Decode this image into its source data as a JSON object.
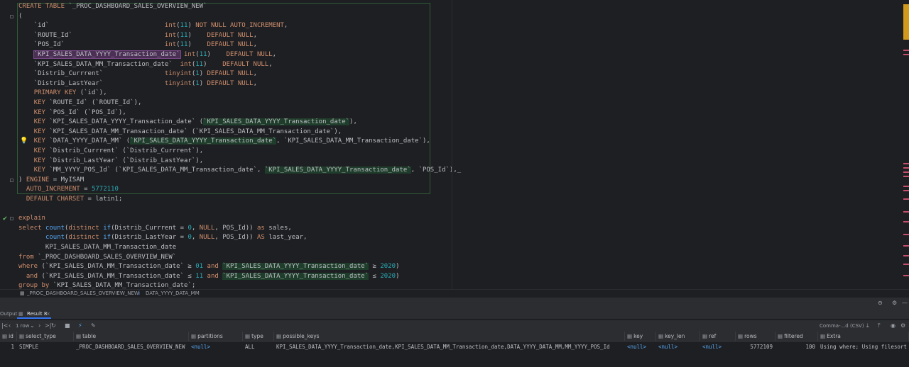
{
  "editor": {
    "lines": [
      [
        [
          "kw",
          "CREATE TABLE "
        ],
        [
          "id",
          "`_PROC_DASHBOARD_SALES_OVERVIEW_NEW`"
        ]
      ],
      [
        [
          "id",
          "("
        ]
      ],
      [
        [
          "id",
          "    `id`                              "
        ],
        [
          "kw",
          "int"
        ],
        [
          "id",
          "("
        ],
        [
          "num",
          "11"
        ],
        [
          "id",
          ") "
        ],
        [
          "kw",
          "NOT NULL AUTO_INCREMENT"
        ],
        [
          "id",
          ","
        ]
      ],
      [
        [
          "id",
          "    `ROUTE_Id`                        "
        ],
        [
          "kw",
          "int"
        ],
        [
          "id",
          "("
        ],
        [
          "num",
          "11"
        ],
        [
          "id",
          ")    "
        ],
        [
          "kw",
          "DEFAULT NULL"
        ],
        [
          "id",
          ","
        ]
      ],
      [
        [
          "id",
          "    `POS_Id`                          "
        ],
        [
          "kw",
          "int"
        ],
        [
          "id",
          "("
        ],
        [
          "num",
          "11"
        ],
        [
          "id",
          ")    "
        ],
        [
          "kw",
          "DEFAULT NULL"
        ],
        [
          "id",
          ","
        ]
      ],
      [
        [
          "id",
          "    "
        ],
        [
          "hl-purple",
          "`KPI_SALES_DATA_YYYY_Transaction_date`"
        ],
        [
          "id",
          " "
        ],
        [
          "kw",
          "int"
        ],
        [
          "id",
          "("
        ],
        [
          "num",
          "11"
        ],
        [
          "id",
          ")    "
        ],
        [
          "kw",
          "DEFAULT NULL"
        ],
        [
          "id",
          ","
        ]
      ],
      [
        [
          "id",
          "    `KPI_SALES_DATA_MM_Transaction_date`  "
        ],
        [
          "kw",
          "int"
        ],
        [
          "id",
          "("
        ],
        [
          "num",
          "11"
        ],
        [
          "id",
          ")    "
        ],
        [
          "kw",
          "DEFAULT NULL"
        ],
        [
          "id",
          ","
        ]
      ],
      [
        [
          "id",
          "    `Distrib_Currrent`                "
        ],
        [
          "kw",
          "tinyint"
        ],
        [
          "id",
          "("
        ],
        [
          "num",
          "1"
        ],
        [
          "id",
          ") "
        ],
        [
          "kw",
          "DEFAULT NULL"
        ],
        [
          "id",
          ","
        ]
      ],
      [
        [
          "id",
          "    `Distrib_LastYear`                "
        ],
        [
          "kw",
          "tinyint"
        ],
        [
          "id",
          "("
        ],
        [
          "num",
          "1"
        ],
        [
          "id",
          ") "
        ],
        [
          "kw",
          "DEFAULT NULL"
        ],
        [
          "id",
          ","
        ]
      ],
      [
        [
          "id",
          "    "
        ],
        [
          "kw",
          "PRIMARY KEY"
        ],
        [
          "id",
          " (`id`),"
        ]
      ],
      [
        [
          "id",
          "    "
        ],
        [
          "kw",
          "KEY"
        ],
        [
          "id",
          " `ROUTE_Id` (`ROUTE_Id`),"
        ]
      ],
      [
        [
          "id",
          "    "
        ],
        [
          "kw",
          "KEY"
        ],
        [
          "id",
          " `POS_Id` (`POS_Id`),"
        ]
      ],
      [
        [
          "id",
          "    "
        ],
        [
          "kw",
          "KEY"
        ],
        [
          "id",
          " `KPI_SALES_DATA_YYYY_Transaction_date` ("
        ],
        [
          "hl-green",
          "`KPI_SALES_DATA_YYYY_Transaction_date`"
        ],
        [
          "id",
          "),"
        ]
      ],
      [
        [
          "id",
          "    "
        ],
        [
          "kw",
          "KEY"
        ],
        [
          "id",
          " `KPI_SALES_DATA_MM_Transaction_date` (`KPI_SALES_DATA_MM_Transaction_date`),"
        ]
      ],
      [
        [
          "id",
          "    "
        ],
        [
          "kw",
          "KEY"
        ],
        [
          "id",
          " `DATA_YYYY_DATA_MM` ("
        ],
        [
          "hl-green",
          "`KPI_SALES_DATA_YYYY_Transaction_date`"
        ],
        [
          "id",
          ", `KPI_SALES_DATA_MM_Transaction_date`),"
        ]
      ],
      [
        [
          "id",
          "    "
        ],
        [
          "kw",
          "KEY"
        ],
        [
          "id",
          " `Distrib_Currrent` (`Distrib_Currrent`),"
        ]
      ],
      [
        [
          "id",
          "    "
        ],
        [
          "kw",
          "KEY"
        ],
        [
          "id",
          " `Distrib_LastYear` (`Distrib_LastYear`),"
        ]
      ],
      [
        [
          "id",
          "    "
        ],
        [
          "kw",
          "KEY"
        ],
        [
          "id",
          " `MM_YYYY_POS_Id` (`KPI_SALES_DATA_MM_Transaction_date`, "
        ],
        [
          "hl-green",
          "`KPI_SALES_DATA_YYYY_Transaction_date`"
        ],
        [
          "id",
          ", `POS_Id`),_"
        ]
      ],
      [
        [
          "id",
          ") "
        ],
        [
          "kw",
          "ENGINE"
        ],
        [
          "id",
          " = MyISAM"
        ]
      ],
      [
        [
          "id",
          "  "
        ],
        [
          "kw",
          "AUTO_INCREMENT"
        ],
        [
          "id",
          " = "
        ],
        [
          "num",
          "5772110"
        ]
      ],
      [
        [
          "id",
          "  "
        ],
        [
          "kw",
          "DEFAULT CHARSET"
        ],
        [
          "id",
          " = latin1;"
        ]
      ],
      [
        [
          "id",
          ""
        ]
      ],
      [
        [
          "kw",
          "explain"
        ]
      ],
      [
        [
          "kw",
          "select "
        ],
        [
          "fn",
          "count"
        ],
        [
          "id",
          "("
        ],
        [
          "kw",
          "distinct "
        ],
        [
          "fn",
          "if"
        ],
        [
          "id",
          "(Distrib_Currrent = "
        ],
        [
          "num",
          "0"
        ],
        [
          "id",
          ", "
        ],
        [
          "kw",
          "NULL"
        ],
        [
          "id",
          ", POS_Id)) "
        ],
        [
          "kw",
          "as"
        ],
        [
          "id",
          " sales,"
        ]
      ],
      [
        [
          "id",
          "       "
        ],
        [
          "fn",
          "count"
        ],
        [
          "id",
          "("
        ],
        [
          "kw",
          "distinct "
        ],
        [
          "fn",
          "if"
        ],
        [
          "id",
          "(Distrib_LastYear = "
        ],
        [
          "num",
          "0"
        ],
        [
          "id",
          ", "
        ],
        [
          "kw",
          "NULL"
        ],
        [
          "id",
          ", POS_Id)) "
        ],
        [
          "kw",
          "AS"
        ],
        [
          "id",
          " last_year,"
        ]
      ],
      [
        [
          "id",
          "       KPI_SALES_DATA_MM_Transaction_date"
        ]
      ],
      [
        [
          "kw",
          "from "
        ],
        [
          "id",
          "`_PROC_DASHBOARD_SALES_OVERVIEW_NEW`"
        ]
      ],
      [
        [
          "kw",
          "where"
        ],
        [
          "id",
          " (`KPI_SALES_DATA_MM_Transaction_date` ≥ "
        ],
        [
          "num",
          "01"
        ],
        [
          "kw",
          " and "
        ],
        [
          "hl-green",
          "`KPI_SALES_DATA_YYYY_Transaction_date`"
        ],
        [
          "id",
          " ≥ "
        ],
        [
          "num",
          "2020"
        ],
        [
          "id",
          ")"
        ]
      ],
      [
        [
          "id",
          "  "
        ],
        [
          "kw",
          "and"
        ],
        [
          "id",
          " (`KPI_SALES_DATA_MM_Transaction_date` ≤ "
        ],
        [
          "num",
          "11"
        ],
        [
          "kw",
          " and "
        ],
        [
          "hl-green",
          "`KPI_SALES_DATA_YYYY_Transaction_date`"
        ],
        [
          "id",
          " ≤ "
        ],
        [
          "num",
          "2020"
        ],
        [
          "id",
          ")"
        ]
      ],
      [
        [
          "kw",
          "group by"
        ],
        [
          "id",
          " `KPI_SALES_DATA_MM_Transaction_date`;"
        ]
      ]
    ]
  },
  "breadcrumb": {
    "table": "_PROC_DASHBOARD_SALES_OVERVIEW_NEW",
    "index": "DATA_YYYY_DATA_MM"
  },
  "tabs": {
    "output": "Output",
    "result": "Result 8"
  },
  "toolbar": {
    "rows": "1 row",
    "export": "Comma-...d (CSV)"
  },
  "table": {
    "headers": [
      "id",
      "select_type",
      "table",
      "partitions",
      "type",
      "possible_keys",
      "key",
      "key_len",
      "ref",
      "rows",
      "filtered",
      "Extra"
    ],
    "row": [
      "1",
      "SIMPLE",
      "_PROC_DASHBOARD_SALES_OVERVIEW_NEW",
      "<null>",
      "ALL",
      "KPI_SALES_DATA_YYYY_Transaction_date,KPI_SALES_DATA_MM_Transaction_date,DATA_YYYY_DATA_MM,MM_YYYY_POS_Id",
      "<null>",
      "<null>",
      "<null>",
      "5772109",
      "100",
      "Using where; Using filesort"
    ]
  },
  "colors": {
    "background": "#1e1f22",
    "keyword": "#cf8e6d",
    "number": "#2aacb8",
    "null": "#56a8f5"
  }
}
